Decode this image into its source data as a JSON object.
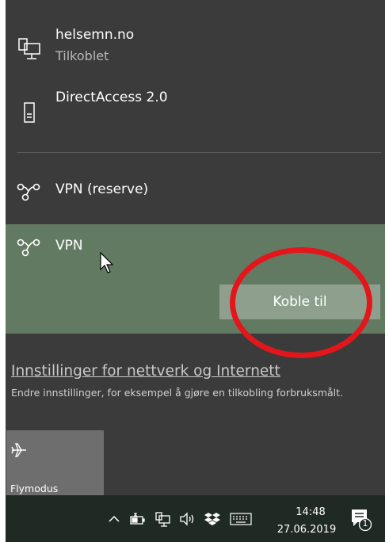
{
  "networks": [
    {
      "name": "helsemn.no",
      "status": "Tilkoblet",
      "icon": "ethernet-icon"
    },
    {
      "name": "DirectAccess 2.0",
      "icon": "phone-device-icon"
    }
  ],
  "vpn": [
    {
      "name": "VPN (reserve)",
      "icon": "vpn-icon"
    },
    {
      "name": "VPN",
      "icon": "vpn-icon",
      "selected": true,
      "action_label": "Koble til"
    }
  ],
  "settings": {
    "link": "Innstillinger for nettverk og Internett",
    "description": "Endre innstillinger, for eksempel å gjøre en tilkobling forbruksmålt."
  },
  "quick_actions": [
    {
      "label": "Flymodus",
      "icon": "airplane-icon"
    }
  ],
  "taskbar": {
    "time": "14:48",
    "date": "27.06.2019",
    "notification_count": "1",
    "tray_icons": [
      "chevron-up-icon",
      "battery-icon",
      "network-icon",
      "volume-icon",
      "dropbox-icon",
      "keyboard-icon"
    ]
  },
  "colors": {
    "flyout_bg": "#3b3b3b",
    "selected_bg": "#637a62",
    "button_bg": "#8ea08d",
    "annotation_ring": "#e3161b",
    "taskbar_bg": "#1f2a25"
  }
}
